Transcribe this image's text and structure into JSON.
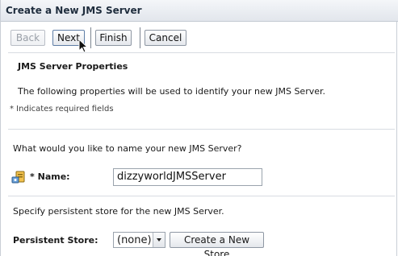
{
  "window": {
    "title": "Create a New JMS Server"
  },
  "toolbar": {
    "back_label": "Back",
    "next_label": "Next",
    "finish_label": "Finish",
    "cancel_label": "Cancel"
  },
  "section": {
    "heading": "JMS Server Properties",
    "description": "The following properties will be used to identify your new JMS Server.",
    "required_note": "* Indicates required fields"
  },
  "name_field": {
    "question": "What would you like to name your new JMS Server?",
    "required_marker": "*",
    "label": "Name:",
    "value": "dizzyworldJMSServer",
    "icon": "server-config-icon"
  },
  "store_field": {
    "instruction": "Specify persistent store for the new JMS Server.",
    "label": "Persistent Store:",
    "selected": "(none)",
    "create_button_label": "Create a New Store"
  }
}
